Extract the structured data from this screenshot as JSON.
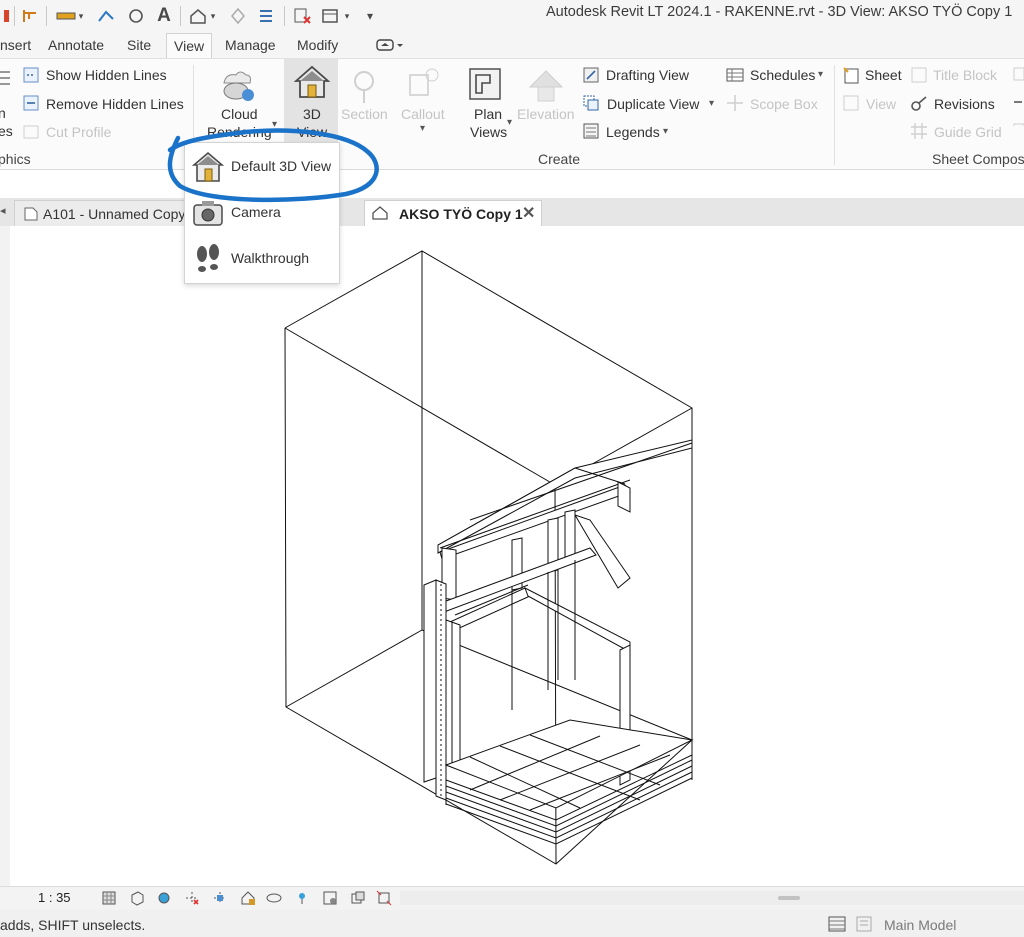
{
  "title": "Autodesk Revit LT 2024.1 - RAKENNE.rvt - 3D View: AKSO TYÖ Copy 1",
  "tabs": [
    {
      "label": "nsert"
    },
    {
      "label": "Annotate"
    },
    {
      "label": "Site"
    },
    {
      "label": "View",
      "active": true
    },
    {
      "label": "Manage"
    },
    {
      "label": "Modify"
    }
  ],
  "ribbon": {
    "graphics": {
      "clip_left_top": "n",
      "clip_left_bottom": "es",
      "show_hidden_lines": "Show  Hidden Lines",
      "remove_hidden_lines": "Remove  Hidden Lines",
      "cut_profile": "Cut  Profile",
      "panel_title": "phics"
    },
    "cloud_rendering": {
      "line1": "Cloud",
      "line2": "Rendering"
    },
    "view_3d": {
      "line1": "3D",
      "line2": "View"
    },
    "section": "Section",
    "callout": "Callout",
    "plan_views": {
      "line1": "Plan",
      "line2": "Views"
    },
    "elevation": "Elevation",
    "drafting_view": "Drafting  View",
    "duplicate_view": "Duplicate  View",
    "legends": "Legends",
    "schedules": "Schedules",
    "scope_box": "Scope  Box",
    "create_panel_title": "Create",
    "sheet": "Sheet",
    "title_block": "Title  Block",
    "view": "View",
    "revisions": "Revisions",
    "guide_grid": "Guide  Grid",
    "sheet_panel_title": "Sheet Composi"
  },
  "dropdown": {
    "items": [
      {
        "label": "Default 3D View",
        "icon": "house-icon"
      },
      {
        "label": "Camera",
        "icon": "camera-icon"
      },
      {
        "label": "Walkthrough",
        "icon": "footprints-icon"
      }
    ]
  },
  "view_tabs": [
    {
      "label": "A101 - Unnamed Copy",
      "active": false
    },
    {
      "label": "AKSO TYÖ Copy 1",
      "active": true
    }
  ],
  "view_control_bar": {
    "scale": "1 : 35"
  },
  "status_bar": {
    "hint": "adds, SHIFT unselects.",
    "workset": "Main Model"
  },
  "colors": {
    "annotation_circle": "#1a73c9",
    "ribbon_background": "#fbfbfb",
    "selected_button": "#e3e3e3"
  }
}
